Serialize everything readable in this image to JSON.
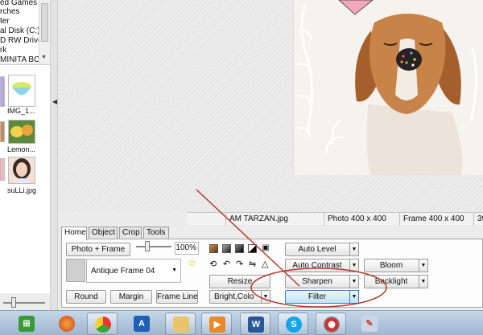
{
  "tree": {
    "items": [
      "ed Games",
      "rches",
      "ter",
      "al Disk (C:)",
      "D RW Drive",
      "rk",
      "MINITA BC"
    ]
  },
  "thumbnails": [
    {
      "label": "IMG_1..."
    },
    {
      "label": "Lemon..."
    },
    {
      "label": "suLLi.jpg"
    }
  ],
  "status": {
    "filename": "AM TARZAN.jpg",
    "photo_size": "Photo 400 x 400",
    "frame_size": "Frame 400 x 400",
    "extra": "39"
  },
  "tabs": [
    {
      "label": "Home",
      "active": true
    },
    {
      "label": "Object",
      "active": false
    },
    {
      "label": "Crop",
      "active": false
    },
    {
      "label": "Tools",
      "active": false
    }
  ],
  "home": {
    "photo_frame_button": "Photo + Frame",
    "zoom": "100%",
    "frame_name": "Antique Frame 04",
    "round_button": "Round",
    "margin_button": "Margin",
    "frame_line_button": "Frame Line",
    "resize_button": "Resize",
    "bright_color_button": "Bright,Colo",
    "auto_level_button": "Auto Level",
    "auto_contrast_button": "Auto Contrast",
    "sharpen_button": "Sharpen",
    "filter_button": "Filter",
    "bloom_button": "Bloom",
    "backlight_button": "Backlight"
  },
  "colors": {
    "annotation": "#c0392b",
    "filter_highlight": "#bfe3f8",
    "taskbar": "#9db6d0"
  },
  "taskbar": {
    "apps": [
      "start-orb",
      "firefox-icon",
      "chrome-icon",
      "app-a-icon",
      "file-explorer-icon",
      "media-player-icon",
      "word-icon",
      "skype-icon",
      "photoscape-icon",
      "paint-icon"
    ]
  }
}
